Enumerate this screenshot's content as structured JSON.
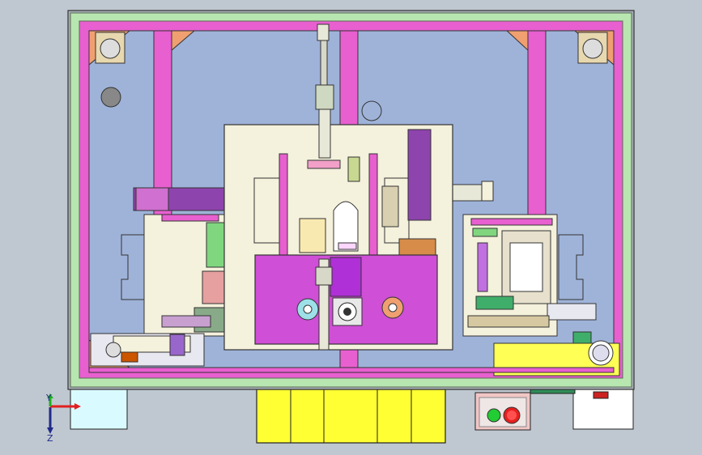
{
  "viewport": {
    "background": "#bfc8d0",
    "colors": {
      "frame_green": "#b8e6b0",
      "frame_edge": "#5a6b55",
      "rail_magenta": "#e85fd0",
      "panel_blue": "#9fb3d9",
      "plate_cream": "#f4f1dc",
      "plate_magenta": "#cf4fd6",
      "accent_purple": "#8e44ad",
      "accent_orange": "#f0a070",
      "button_yellow": "#ffff33",
      "foot_light": "#d9fbff",
      "btn_green": "#22cc33",
      "btn_red": "#e61f1f"
    }
  },
  "axis_triad": {
    "y_label": "Y",
    "z_label": "Z",
    "x_color": "#e02020",
    "y_color": "#20b020",
    "z_color": "#1f2a8a"
  },
  "control_box": {
    "start_button": "green",
    "stop_button": "red"
  },
  "yellow_panel": {
    "segments": 5
  }
}
